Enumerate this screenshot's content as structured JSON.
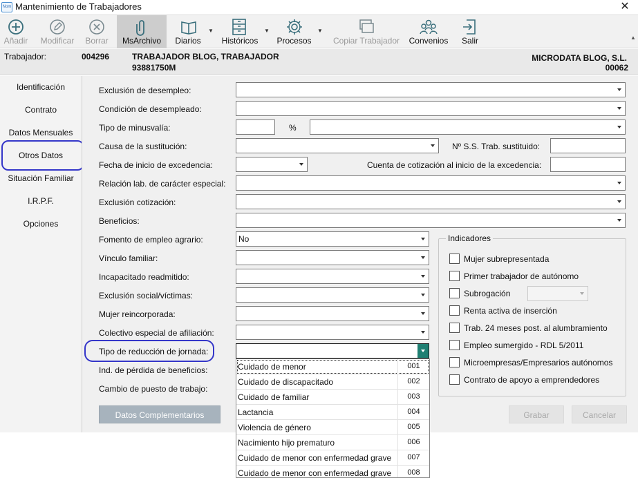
{
  "window": {
    "title": "Mantenimiento de Trabajadores",
    "app_icon_text": "Nom"
  },
  "toolbar": {
    "buttons": [
      {
        "label": "Añadir",
        "icon": "plus-circle-icon"
      },
      {
        "label": "Modificar",
        "icon": "pencil-circle-icon"
      },
      {
        "label": "Borrar",
        "icon": "x-circle-icon"
      },
      {
        "label": "MsArchivo",
        "icon": "paperclip-icon"
      },
      {
        "label": "Diarios",
        "icon": "book-icon"
      },
      {
        "label": "Históricos",
        "icon": "cabinet-icon"
      },
      {
        "label": "Procesos",
        "icon": "gear-icon"
      },
      {
        "label": "Copiar Trabajador",
        "icon": "copy-icon"
      },
      {
        "label": "Convenios",
        "icon": "people-icon"
      },
      {
        "label": "Salir",
        "icon": "exit-icon"
      }
    ]
  },
  "header": {
    "trabajador_label": "Trabajador:",
    "codigo": "004296",
    "nombre": "TRABAJADOR BLOG, TRABAJADOR",
    "dni": "93881750M",
    "empresa": "MICRODATA BLOG, S.L.",
    "empresa_codigo": "00062"
  },
  "sidebar": {
    "items": [
      "Identificación",
      "Contrato",
      "Datos Mensuales",
      "Otros Datos",
      "Situación Familiar",
      "I.R.P.F.",
      "Opciones"
    ]
  },
  "form": {
    "exclusion_desempleo": "Exclusión de desempleo:",
    "condicion_desempleado": "Condición de desempleado:",
    "tipo_minusvalia": "Tipo de minusvalía:",
    "percent": "%",
    "causa_sustitucion": "Causa de la sustitución:",
    "nss_sustituido": "Nº S.S. Trab. sustituido:",
    "fecha_excedencia": "Fecha de inicio de excedencia:",
    "cuenta_cotizacion": "Cuenta de cotización al inicio de la excedencia:",
    "relacion_especial": "Relación lab. de carácter especial:",
    "exclusion_cotizacion": "Exclusión cotización:",
    "beneficios": "Beneficios:",
    "fomento_agrario": "Fomento de empleo agrario:",
    "fomento_agrario_value": "No",
    "vinculo_familiar": "Vínculo familiar:",
    "incapacitado": "Incapacitado readmitido:",
    "exclusion_social": "Exclusión social/víctimas:",
    "mujer_reincorporada": "Mujer reincorporada:",
    "colectivo_especial": "Colectivo especial de afiliación:",
    "tipo_reduccion": "Tipo de reducción de jornada:",
    "ind_perdida": "Ind. de pérdida de beneficios:",
    "cambio_puesto": "Cambio de puesto de trabajo:"
  },
  "indicadores": {
    "title": "Indicadores",
    "items": [
      "Mujer subrepresentada",
      "Primer trabajador de autónomo",
      "Subrogación",
      "Renta activa de inserción",
      "Trab. 24 meses post. al alumbramiento",
      "Empleo sumergido - RDL 5/2011",
      "Microempresas/Empresarios autónomos",
      "Contrato de apoyo a emprendedores"
    ]
  },
  "buttons": {
    "datos": "Datos Complementarios",
    "grabar": "Grabar",
    "cancelar": "Cancelar"
  },
  "dropdown": {
    "options": [
      {
        "label": "Cuidado de menor",
        "code": "001"
      },
      {
        "label": "Cuidado de discapacitado",
        "code": "002"
      },
      {
        "label": "Cuidado de familiar",
        "code": "003"
      },
      {
        "label": "Lactancia",
        "code": "004"
      },
      {
        "label": "Violencia de género",
        "code": "005"
      },
      {
        "label": "Nacimiento hijo prematuro",
        "code": "006"
      },
      {
        "label": "Cuidado de menor con enfermedad grave",
        "code": "007"
      },
      {
        "label": "Cuidado de menor con enfermedad grave",
        "code": "008"
      }
    ]
  },
  "colors": {
    "accent_circle": "#3436c9",
    "dropdown_arrow": "#1f7f72",
    "toolbar_icon": "#3a6f7c"
  }
}
